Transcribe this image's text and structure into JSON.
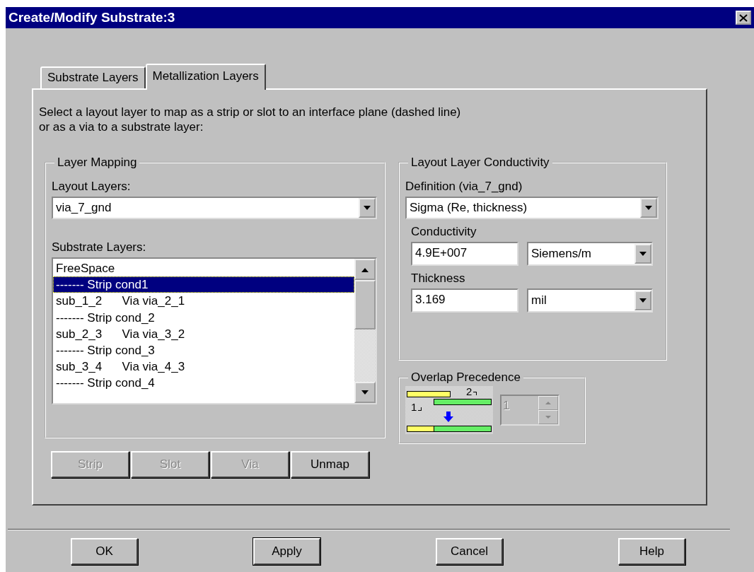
{
  "window": {
    "title": "Create/Modify Substrate:3"
  },
  "tabs": [
    {
      "label": "Substrate Layers",
      "selected": false
    },
    {
      "label": "Metallization Layers",
      "selected": true
    }
  ],
  "instructions": "Select a layout layer to map as a strip or slot to an interface plane (dashed line)\nor as a via to a substrate layer:",
  "layer_mapping": {
    "title": "Layer Mapping",
    "layout_layers_label": "Layout Layers:",
    "layout_layer": "via_7_gnd",
    "substrate_layers_label": "Substrate Layers:",
    "substrate_layers": [
      {
        "label": "FreeSpace",
        "selected": false
      },
      {
        "label": "------- Strip cond1",
        "selected": true
      },
      {
        "label": "sub_1_2      Via via_2_1",
        "selected": false
      },
      {
        "label": "------- Strip cond_2",
        "selected": false
      },
      {
        "label": "sub_2_3      Via via_3_2",
        "selected": false
      },
      {
        "label": "------- Strip cond_3",
        "selected": false
      },
      {
        "label": "sub_3_4      Via via_4_3",
        "selected": false
      },
      {
        "label": "------- Strip cond_4",
        "selected": false
      }
    ],
    "buttons": [
      {
        "label": "Strip",
        "disabled": true
      },
      {
        "label": "Slot",
        "disabled": true
      },
      {
        "label": "Via",
        "disabled": true
      },
      {
        "label": "Unmap",
        "disabled": false
      }
    ]
  },
  "conductivity": {
    "title": "Layout Layer Conductivity",
    "definition_label": "Definition (via_7_gnd)",
    "definition": "Sigma (Re, thickness)",
    "conductivity_label": "Conductivity",
    "conductivity_value": "4.9E+007",
    "conductivity_unit": "Siemens/m",
    "thickness_label": "Thickness",
    "thickness_value": "3.169",
    "thickness_unit": "mil"
  },
  "overlap": {
    "title": "Overlap Precedence",
    "diagram_labels": [
      "2",
      "1"
    ],
    "value": "1",
    "disabled": true
  },
  "buttons": [
    {
      "label": "OK",
      "default": false
    },
    {
      "label": "Apply",
      "default": true
    },
    {
      "label": "Cancel",
      "default": false
    },
    {
      "label": "Help",
      "default": false
    }
  ]
}
